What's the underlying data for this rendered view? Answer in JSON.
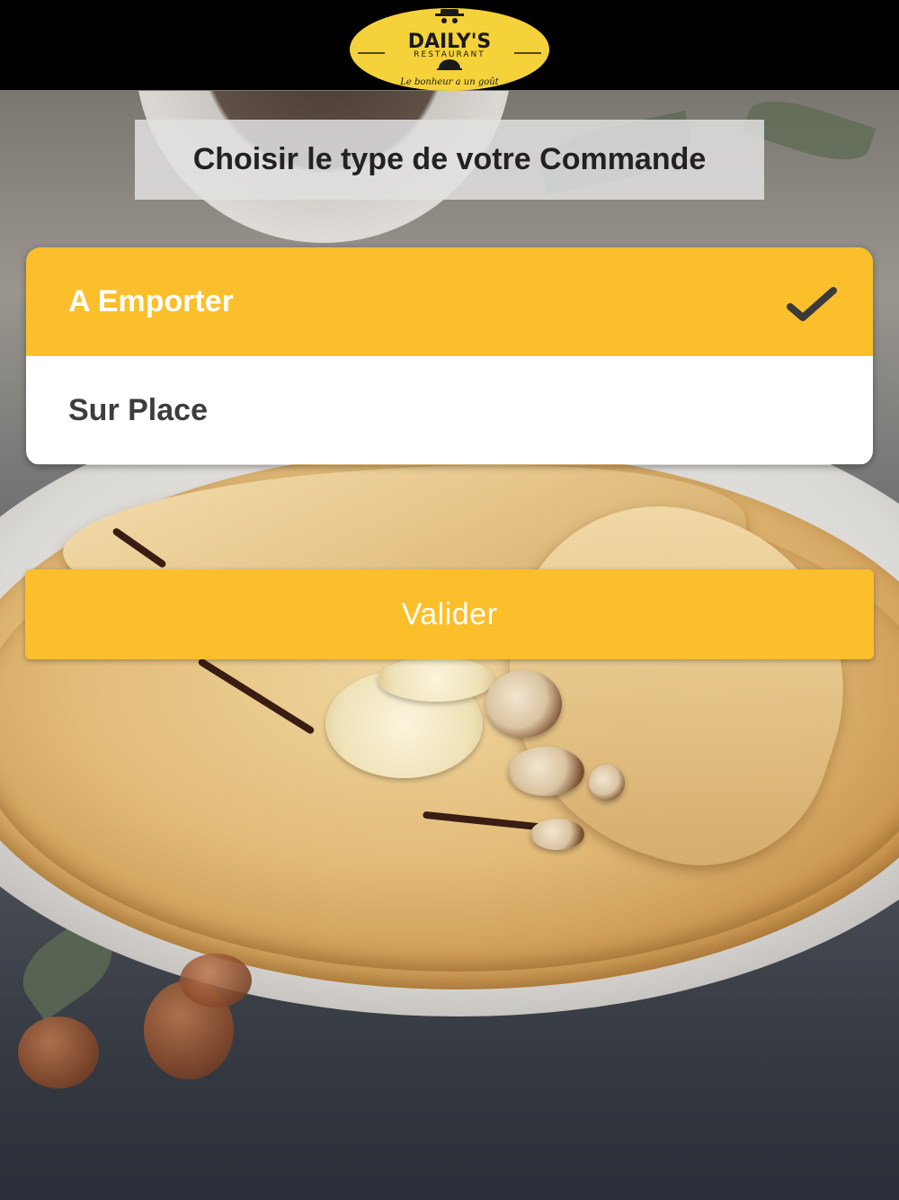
{
  "header": {
    "logo": {
      "name": "DAILY'S",
      "subtitle": "RESTAURANT",
      "tagline": "Le bonheur a un goût"
    }
  },
  "title": "Choisir le type de votre Commande",
  "options": [
    {
      "label": "A Emporter",
      "selected": true
    },
    {
      "label": "Sur Place",
      "selected": false
    }
  ],
  "validate_button": {
    "label": "Valider"
  },
  "colors": {
    "accent": "#fbbf2c",
    "header_bg": "#000000",
    "check": "#3a3a3a"
  },
  "icons": {
    "selected_indicator": "checkmark-icon"
  }
}
